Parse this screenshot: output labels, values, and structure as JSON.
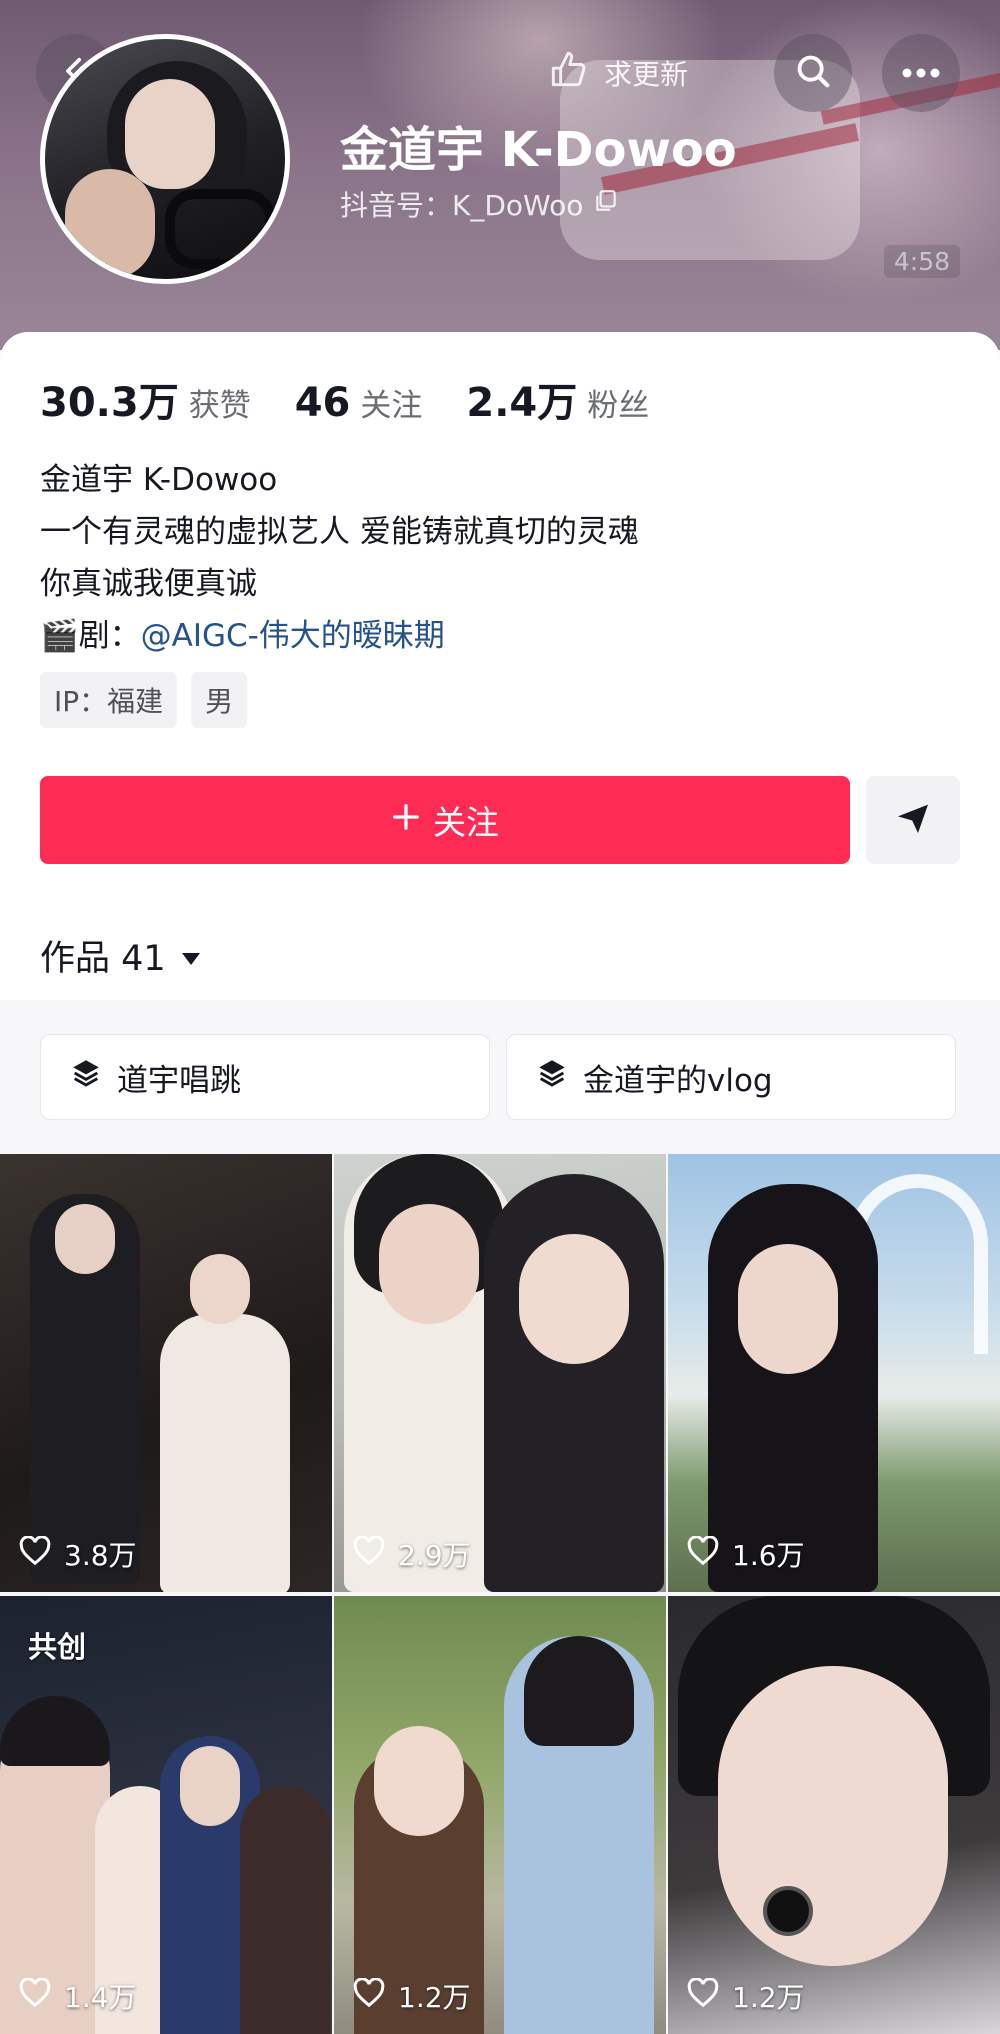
{
  "header": {
    "update_label": "求更新",
    "name": "金道宇 K-Dowoo",
    "douyin_id": "抖音号：K_DoWoo",
    "video_timestamp": "4:58",
    "colors": {
      "accent": "#fe2c55",
      "link": "#25538c"
    }
  },
  "stats": [
    {
      "value": "30.3万",
      "label": "获赞"
    },
    {
      "value": "46",
      "label": "关注"
    },
    {
      "value": "2.4万",
      "label": "粉丝"
    }
  ],
  "bio": {
    "line1": "金道宇 K-Dowoo",
    "line2": "一个有灵魂的虚拟艺人 爱能铸就真切的灵魂",
    "line3": "你真诚我便真诚",
    "drama_emoji": "🎬",
    "drama_label": "剧：",
    "drama_link": "@AIGC-伟大的暧昧期"
  },
  "tags": [
    "IP：福建",
    "男"
  ],
  "actions": {
    "follow_label": "关注"
  },
  "works": {
    "label": "作品 41"
  },
  "collections": [
    {
      "label": "道宇唱跳"
    },
    {
      "label": "金道宇的vlog"
    }
  ],
  "videos": [
    {
      "likes": "3.8万"
    },
    {
      "likes": "2.9万"
    },
    {
      "likes": "1.6万"
    },
    {
      "likes": "1.4万",
      "badge": "共创"
    },
    {
      "likes": "1.2万"
    },
    {
      "likes": "1.2万"
    }
  ]
}
